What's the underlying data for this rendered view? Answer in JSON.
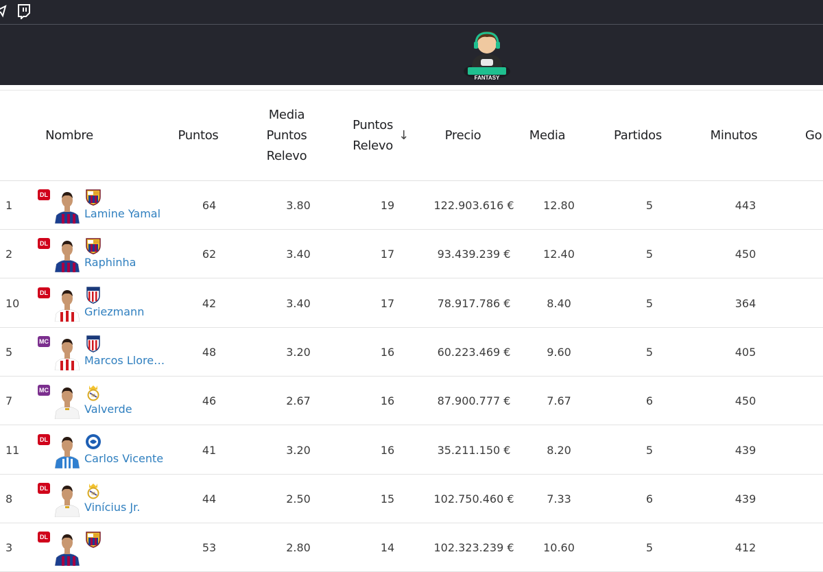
{
  "colors": {
    "header_bg": "#25262e",
    "link": "#2f7fbf",
    "badge_dl": "#d0021b",
    "badge_mc": "#7b2f8e"
  },
  "logo": {
    "icon": "gamer-logo-icon",
    "text": "FANTASY"
  },
  "table": {
    "headers": {
      "nombre": "Nombre",
      "puntos": "Puntos",
      "media_relevo_1": "Media",
      "media_relevo_2": "Puntos",
      "media_relevo_3": "Relevo",
      "puntos_relevo_1": "Puntos",
      "puntos_relevo_2": "Relevo",
      "precio": "Precio",
      "media": "Media",
      "partidos": "Partidos",
      "minutos": "Minutos",
      "goles": "Gol"
    },
    "rows": [
      {
        "rank": "1",
        "pos": "DL",
        "name": "Lamine Yamal",
        "team": "barcelona",
        "kit": "barcelona",
        "puntos": "64",
        "media_relevo": "3.80",
        "puntos_relevo": "19",
        "precio": "122.903.616 €",
        "media": "12.80",
        "partidos": "5",
        "minutos": "443"
      },
      {
        "rank": "2",
        "pos": "DL",
        "name": "Raphinha",
        "team": "barcelona",
        "kit": "barcelona",
        "puntos": "62",
        "media_relevo": "3.40",
        "puntos_relevo": "17",
        "precio": "93.439.239 €",
        "media": "12.40",
        "partidos": "5",
        "minutos": "450"
      },
      {
        "rank": "10",
        "pos": "DL",
        "name": "Griezmann",
        "team": "atletico",
        "kit": "atletico",
        "puntos": "42",
        "media_relevo": "3.40",
        "puntos_relevo": "17",
        "precio": "78.917.786 €",
        "media": "8.40",
        "partidos": "5",
        "minutos": "364"
      },
      {
        "rank": "5",
        "pos": "MC",
        "name": "Marcos Llorente",
        "team": "atletico",
        "kit": "atletico",
        "puntos": "48",
        "media_relevo": "3.20",
        "puntos_relevo": "16",
        "precio": "60.223.469 €",
        "media": "9.60",
        "partidos": "5",
        "minutos": "405"
      },
      {
        "rank": "7",
        "pos": "MC",
        "name": "Valverde",
        "team": "real-madrid",
        "kit": "madrid",
        "puntos": "46",
        "media_relevo": "2.67",
        "puntos_relevo": "16",
        "precio": "87.900.777 €",
        "media": "7.67",
        "partidos": "6",
        "minutos": "450"
      },
      {
        "rank": "11",
        "pos": "DL",
        "name": "Carlos Vicente",
        "team": "alaves",
        "kit": "alaves",
        "puntos": "41",
        "media_relevo": "3.20",
        "puntos_relevo": "16",
        "precio": "35.211.150 €",
        "media": "8.20",
        "partidos": "5",
        "minutos": "439"
      },
      {
        "rank": "8",
        "pos": "DL",
        "name": "Vinícius Jr.",
        "team": "real-madrid",
        "kit": "madrid",
        "puntos": "44",
        "media_relevo": "2.50",
        "puntos_relevo": "15",
        "precio": "102.750.460 €",
        "media": "7.33",
        "partidos": "6",
        "minutos": "439"
      },
      {
        "rank": "3",
        "pos": "DL",
        "name": "",
        "team": "barcelona",
        "kit": "barcelona",
        "puntos": "53",
        "media_relevo": "2.80",
        "puntos_relevo": "14",
        "precio": "102.323.239 €",
        "media": "10.60",
        "partidos": "5",
        "minutos": "412"
      }
    ]
  }
}
